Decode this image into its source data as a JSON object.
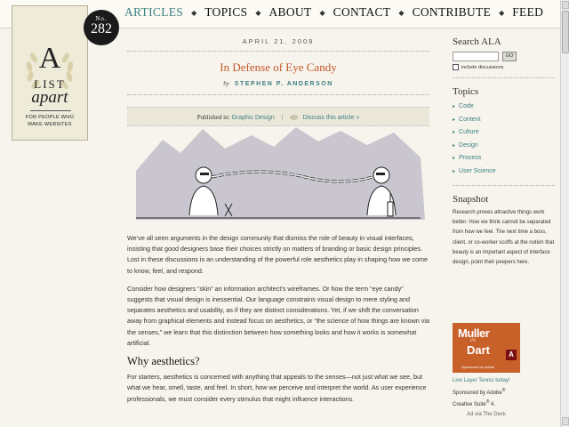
{
  "nav": {
    "items": [
      "ARTICLES",
      "TOPICS",
      "ABOUT",
      "CONTACT",
      "CONTRIBUTE",
      "FEED"
    ],
    "active": "ARTICLES"
  },
  "badge": {
    "no": "No.",
    "num": "282"
  },
  "logo": {
    "a": "A",
    "list": "LIST",
    "apart": "apart",
    "tag1": "FOR PEOPLE WHO",
    "tag2": "MAKE WEBSITES"
  },
  "article": {
    "date": "APRIL 21, 2009",
    "title": "In Defense of Eye Candy",
    "by": "by",
    "author": "STEPHEN P. ANDERSON",
    "published_label": "Published in:",
    "category": "Graphic Design",
    "discuss": "Discuss this article »",
    "p1": "We’ve all seen arguments in the design community that dismiss the role of beauty in visual interfaces, insisting that good designers base their choices strictly on matters of branding or basic design principles. Lost in these discussions is an understanding of the powerful role aesthetics play in shaping how we come to know, feel, and respond.",
    "p2": "Consider how designers “skin” an information architect’s wireframes. Or how the term “eye candy” suggests that visual design is inessential. Our language constrains visual design to mere styling and separates aesthetics and usability, as if they are distinct considerations. Yet, if we shift the conversation away from graphical elements and instead focus on aesthetics, or “the science of how things are known via the senses,” we learn that this distinction between how something looks and how it works is somewhat artificial.",
    "h2": "Why aesthetics?",
    "p3": "For starters, aesthetics is concerned with anything that appeals to the senses—not just what we see, but what we hear, smell, taste, and feel. In short, how we perceive and interpret the world. As user experience professionals, we must consider every stimulus that might influence interactions."
  },
  "sidebar": {
    "search_title": "Search ALA",
    "search_value": "",
    "go_label": "GO",
    "include_label": "include discussions",
    "topics_title": "Topics",
    "topics": [
      "Code",
      "Content",
      "Culture",
      "Design",
      "Process",
      "User Science"
    ],
    "snapshot_title": "Snapshot",
    "snapshot_text": "Research proves attractive things work better. How we think cannot be separated from how we feel. The next time a boss, client, or co-worker scoffs at the notion that beauty is an important aspect of interface design, point their peepers here."
  },
  "ad": {
    "line1": "Muller",
    "vs": "vs",
    "line2": "Dart",
    "adobe": "A",
    "sponsored": "Sponsored by Adobe",
    "promo": "Live Layer Tennis today!",
    "sponsor_line": "Sponsored by Adobe",
    "suite": "Creative Suite",
    "suite_num": "4.",
    "via": "Ad via The Deck"
  }
}
